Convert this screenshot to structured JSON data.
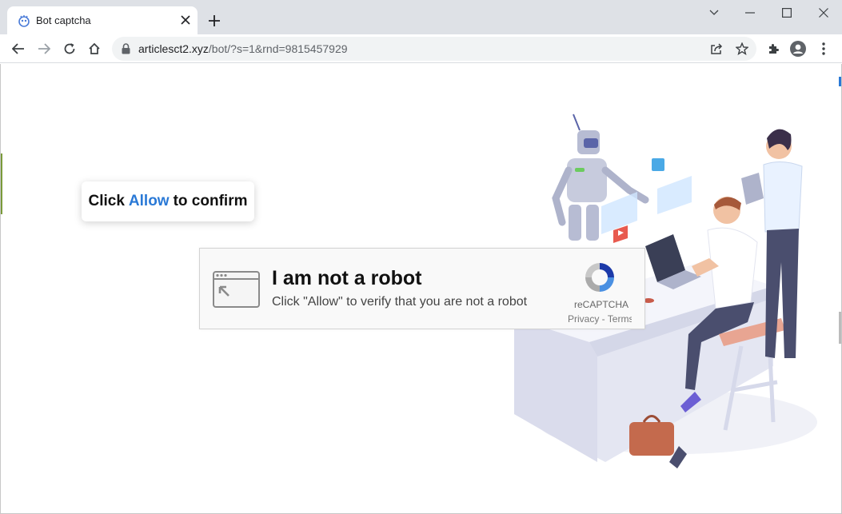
{
  "browser": {
    "tab_title": "Bot captcha",
    "url_host": "articlesct2.xyz",
    "url_path": "/bot/?s=1&rnd=9815457929"
  },
  "page": {
    "confirm_prefix": "Click",
    "confirm_highlight": "Allow",
    "confirm_suffix": "to confirm",
    "highlight_color": "#2a79d6",
    "captcha": {
      "title": "I am not a robot",
      "subtitle": "Click \"Allow\" to verify that you are not a robot",
      "brand": "reCAPTCHA",
      "links": "Privacy - Terms"
    }
  },
  "icons": [
    "tab-favicon-icon",
    "close-icon",
    "plus-icon",
    "chevron-down-icon",
    "minimize-icon",
    "maximize-icon",
    "window-close-icon",
    "back-arrow-icon",
    "forward-arrow-icon",
    "reload-icon",
    "home-icon",
    "lock-icon",
    "share-icon",
    "star-icon",
    "extensions-icon",
    "profile-icon",
    "kebab-menu-icon",
    "browser-window-icon",
    "recaptcha-logo-icon"
  ]
}
